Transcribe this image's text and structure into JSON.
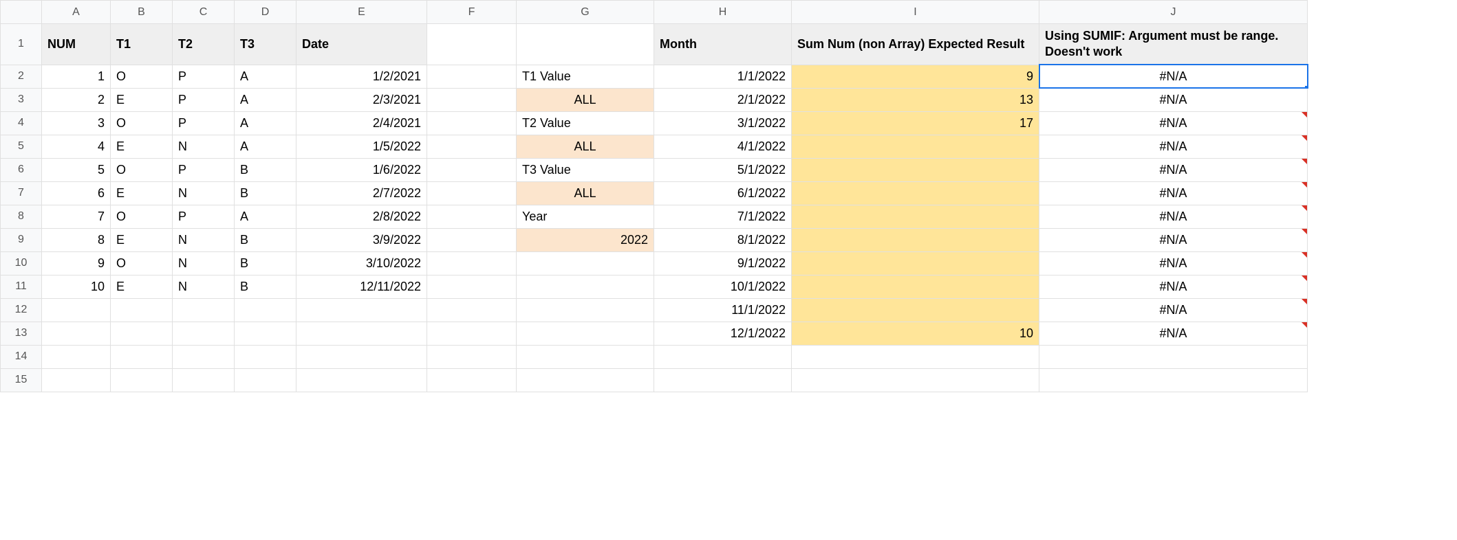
{
  "columns": [
    "A",
    "B",
    "C",
    "D",
    "E",
    "F",
    "G",
    "H",
    "I",
    "J"
  ],
  "rowcount": 15,
  "header": {
    "A": "NUM",
    "B": "T1",
    "C": "T2",
    "D": "T3",
    "E": "Date",
    "H": "Month",
    "I": "Sum Num (non Array) Expected Result",
    "J": "Using SUMIF: Argument must be range. Doesn't work"
  },
  "side_labels": {
    "G2": "T1 Value",
    "G3": "ALL",
    "G4": "T2 Value",
    "G5": "ALL",
    "G6": "T3 Value",
    "G7": "ALL",
    "G8": "Year",
    "G9": "2022"
  },
  "rows": [
    {
      "num": "1",
      "t1": "O",
      "t2": "P",
      "t3": "A",
      "date": "1/2/2021",
      "month": "1/1/2022",
      "sum": "9",
      "sumif": "#N/A"
    },
    {
      "num": "2",
      "t1": "E",
      "t2": "P",
      "t3": "A",
      "date": "2/3/2021",
      "month": "2/1/2022",
      "sum": "13",
      "sumif": "#N/A"
    },
    {
      "num": "3",
      "t1": "O",
      "t2": "P",
      "t3": "A",
      "date": "2/4/2021",
      "month": "3/1/2022",
      "sum": "17",
      "sumif": "#N/A"
    },
    {
      "num": "4",
      "t1": "E",
      "t2": "N",
      "t3": "A",
      "date": "1/5/2022",
      "month": "4/1/2022",
      "sum": "",
      "sumif": "#N/A"
    },
    {
      "num": "5",
      "t1": "O",
      "t2": "P",
      "t3": "B",
      "date": "1/6/2022",
      "month": "5/1/2022",
      "sum": "",
      "sumif": "#N/A"
    },
    {
      "num": "6",
      "t1": "E",
      "t2": "N",
      "t3": "B",
      "date": "2/7/2022",
      "month": "6/1/2022",
      "sum": "",
      "sumif": "#N/A"
    },
    {
      "num": "7",
      "t1": "O",
      "t2": "P",
      "t3": "A",
      "date": "2/8/2022",
      "month": "7/1/2022",
      "sum": "",
      "sumif": "#N/A"
    },
    {
      "num": "8",
      "t1": "E",
      "t2": "N",
      "t3": "B",
      "date": "3/9/2022",
      "month": "8/1/2022",
      "sum": "",
      "sumif": "#N/A"
    },
    {
      "num": "9",
      "t1": "O",
      "t2": "N",
      "t3": "B",
      "date": "3/10/2022",
      "month": "9/1/2022",
      "sum": "",
      "sumif": "#N/A"
    },
    {
      "num": "10",
      "t1": "E",
      "t2": "N",
      "t3": "B",
      "date": "12/11/2022",
      "month": "10/1/2022",
      "sum": "",
      "sumif": "#N/A"
    },
    {
      "num": "",
      "t1": "",
      "t2": "",
      "t3": "",
      "date": "",
      "month": "11/1/2022",
      "sum": "",
      "sumif": "#N/A"
    },
    {
      "num": "",
      "t1": "",
      "t2": "",
      "t3": "",
      "date": "",
      "month": "12/1/2022",
      "sum": "10",
      "sumif": "#N/A"
    }
  ],
  "selected_cell": "J2"
}
